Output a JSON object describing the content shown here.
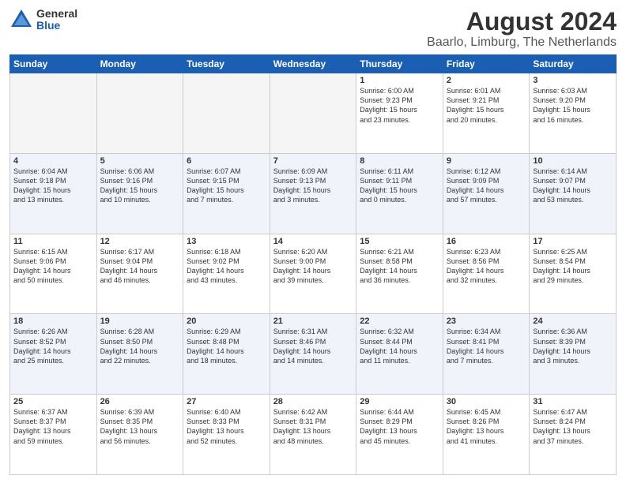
{
  "logo": {
    "general": "General",
    "blue": "Blue"
  },
  "title": "August 2024",
  "subtitle": "Baarlo, Limburg, The Netherlands",
  "headers": [
    "Sunday",
    "Monday",
    "Tuesday",
    "Wednesday",
    "Thursday",
    "Friday",
    "Saturday"
  ],
  "weeks": [
    [
      {
        "day": "",
        "content": ""
      },
      {
        "day": "",
        "content": ""
      },
      {
        "day": "",
        "content": ""
      },
      {
        "day": "",
        "content": ""
      },
      {
        "day": "1",
        "content": "Sunrise: 6:00 AM\nSunset: 9:23 PM\nDaylight: 15 hours\nand 23 minutes."
      },
      {
        "day": "2",
        "content": "Sunrise: 6:01 AM\nSunset: 9:21 PM\nDaylight: 15 hours\nand 20 minutes."
      },
      {
        "day": "3",
        "content": "Sunrise: 6:03 AM\nSunset: 9:20 PM\nDaylight: 15 hours\nand 16 minutes."
      }
    ],
    [
      {
        "day": "4",
        "content": "Sunrise: 6:04 AM\nSunset: 9:18 PM\nDaylight: 15 hours\nand 13 minutes."
      },
      {
        "day": "5",
        "content": "Sunrise: 6:06 AM\nSunset: 9:16 PM\nDaylight: 15 hours\nand 10 minutes."
      },
      {
        "day": "6",
        "content": "Sunrise: 6:07 AM\nSunset: 9:15 PM\nDaylight: 15 hours\nand 7 minutes."
      },
      {
        "day": "7",
        "content": "Sunrise: 6:09 AM\nSunset: 9:13 PM\nDaylight: 15 hours\nand 3 minutes."
      },
      {
        "day": "8",
        "content": "Sunrise: 6:11 AM\nSunset: 9:11 PM\nDaylight: 15 hours\nand 0 minutes."
      },
      {
        "day": "9",
        "content": "Sunrise: 6:12 AM\nSunset: 9:09 PM\nDaylight: 14 hours\nand 57 minutes."
      },
      {
        "day": "10",
        "content": "Sunrise: 6:14 AM\nSunset: 9:07 PM\nDaylight: 14 hours\nand 53 minutes."
      }
    ],
    [
      {
        "day": "11",
        "content": "Sunrise: 6:15 AM\nSunset: 9:06 PM\nDaylight: 14 hours\nand 50 minutes."
      },
      {
        "day": "12",
        "content": "Sunrise: 6:17 AM\nSunset: 9:04 PM\nDaylight: 14 hours\nand 46 minutes."
      },
      {
        "day": "13",
        "content": "Sunrise: 6:18 AM\nSunset: 9:02 PM\nDaylight: 14 hours\nand 43 minutes."
      },
      {
        "day": "14",
        "content": "Sunrise: 6:20 AM\nSunset: 9:00 PM\nDaylight: 14 hours\nand 39 minutes."
      },
      {
        "day": "15",
        "content": "Sunrise: 6:21 AM\nSunset: 8:58 PM\nDaylight: 14 hours\nand 36 minutes."
      },
      {
        "day": "16",
        "content": "Sunrise: 6:23 AM\nSunset: 8:56 PM\nDaylight: 14 hours\nand 32 minutes."
      },
      {
        "day": "17",
        "content": "Sunrise: 6:25 AM\nSunset: 8:54 PM\nDaylight: 14 hours\nand 29 minutes."
      }
    ],
    [
      {
        "day": "18",
        "content": "Sunrise: 6:26 AM\nSunset: 8:52 PM\nDaylight: 14 hours\nand 25 minutes."
      },
      {
        "day": "19",
        "content": "Sunrise: 6:28 AM\nSunset: 8:50 PM\nDaylight: 14 hours\nand 22 minutes."
      },
      {
        "day": "20",
        "content": "Sunrise: 6:29 AM\nSunset: 8:48 PM\nDaylight: 14 hours\nand 18 minutes."
      },
      {
        "day": "21",
        "content": "Sunrise: 6:31 AM\nSunset: 8:46 PM\nDaylight: 14 hours\nand 14 minutes."
      },
      {
        "day": "22",
        "content": "Sunrise: 6:32 AM\nSunset: 8:44 PM\nDaylight: 14 hours\nand 11 minutes."
      },
      {
        "day": "23",
        "content": "Sunrise: 6:34 AM\nSunset: 8:41 PM\nDaylight: 14 hours\nand 7 minutes."
      },
      {
        "day": "24",
        "content": "Sunrise: 6:36 AM\nSunset: 8:39 PM\nDaylight: 14 hours\nand 3 minutes."
      }
    ],
    [
      {
        "day": "25",
        "content": "Sunrise: 6:37 AM\nSunset: 8:37 PM\nDaylight: 13 hours\nand 59 minutes."
      },
      {
        "day": "26",
        "content": "Sunrise: 6:39 AM\nSunset: 8:35 PM\nDaylight: 13 hours\nand 56 minutes."
      },
      {
        "day": "27",
        "content": "Sunrise: 6:40 AM\nSunset: 8:33 PM\nDaylight: 13 hours\nand 52 minutes."
      },
      {
        "day": "28",
        "content": "Sunrise: 6:42 AM\nSunset: 8:31 PM\nDaylight: 13 hours\nand 48 minutes."
      },
      {
        "day": "29",
        "content": "Sunrise: 6:44 AM\nSunset: 8:29 PM\nDaylight: 13 hours\nand 45 minutes."
      },
      {
        "day": "30",
        "content": "Sunrise: 6:45 AM\nSunset: 8:26 PM\nDaylight: 13 hours\nand 41 minutes."
      },
      {
        "day": "31",
        "content": "Sunrise: 6:47 AM\nSunset: 8:24 PM\nDaylight: 13 hours\nand 37 minutes."
      }
    ]
  ]
}
